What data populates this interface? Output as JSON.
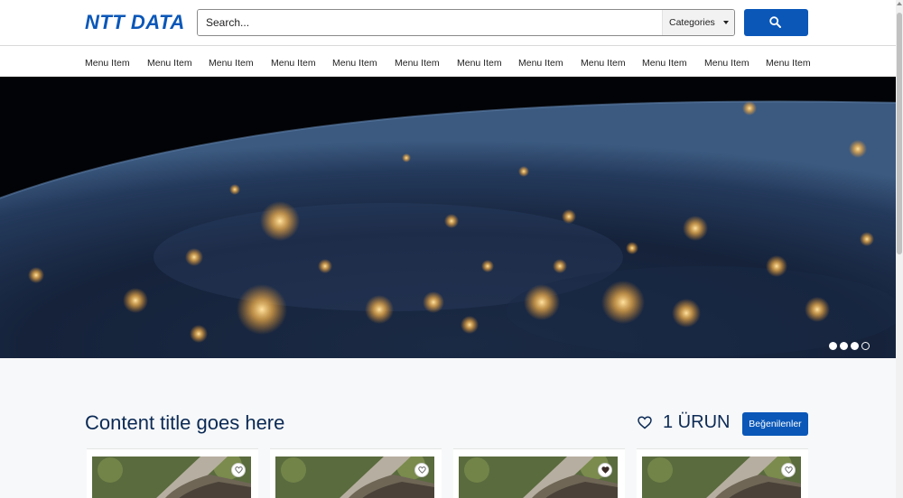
{
  "header": {
    "logo": "NTT DATA",
    "search_placeholder": "Search...",
    "categories_label": "Categories"
  },
  "nav": {
    "items": [
      "Menu Item",
      "Menu Item",
      "Menu Item",
      "Menu Item",
      "Menu Item",
      "Menu Item",
      "Menu Item",
      "Menu Item",
      "Menu Item",
      "Menu Item",
      "Menu Item",
      "Menu Item"
    ]
  },
  "hero": {
    "image": "earth-at-night-from-space",
    "slides_total": 4,
    "active_slide": 4
  },
  "content": {
    "title": "Content title goes here",
    "favorites_count": "1 ÜRUN",
    "favorites_button": "Beğenilenler"
  },
  "cards": [
    {
      "image": "tabby-cat-photo",
      "liked": false
    },
    {
      "image": "tabby-cat-photo",
      "liked": false
    },
    {
      "image": "tabby-cat-photo",
      "liked": true
    },
    {
      "image": "tabby-cat-photo",
      "liked": false
    }
  ],
  "colors": {
    "brand_blue": "#0a57b8",
    "title_navy": "#0b2a55"
  }
}
